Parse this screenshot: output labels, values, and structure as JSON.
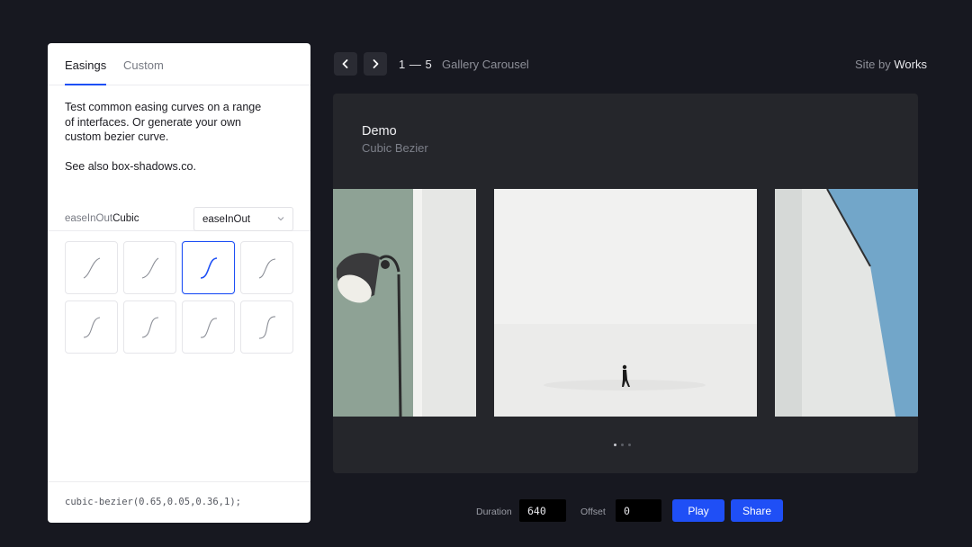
{
  "panel": {
    "tabs": {
      "easings": "Easings",
      "custom": "Custom"
    },
    "intro": "Test common easing curves on a range of interfaces. Or generate your own custom bezier curve.",
    "see_also": "See also box-shadows.co.",
    "easing_name_prefix": "easeInOut",
    "easing_name_suffix": "Cubic",
    "select_value": "easeInOut",
    "selected_curve_index": 2,
    "curve_count": 8,
    "code": "cubic-bezier(0.65,0.05,0.36,1);"
  },
  "topbar": {
    "counter": "1 — 5",
    "title": "Gallery Carousel",
    "site_by_prefix": "Site by",
    "site_by_name": "Works"
  },
  "demo": {
    "title": "Demo",
    "subtitle": "Cubic Bezier",
    "slide_count": 3,
    "active_dot": 0
  },
  "controls": {
    "duration_label": "Duration",
    "duration_value": "640",
    "offset_label": "Offset",
    "offset_value": "0",
    "play_label": "Play",
    "share_label": "Share"
  },
  "colors": {
    "background": "#171820",
    "accent": "#1f4ff6",
    "card": "#25262b",
    "panel": "#ffffff"
  },
  "icons": [
    "chevron-left-icon",
    "chevron-right-icon",
    "chevron-down-icon",
    "easing-curve-icon"
  ]
}
